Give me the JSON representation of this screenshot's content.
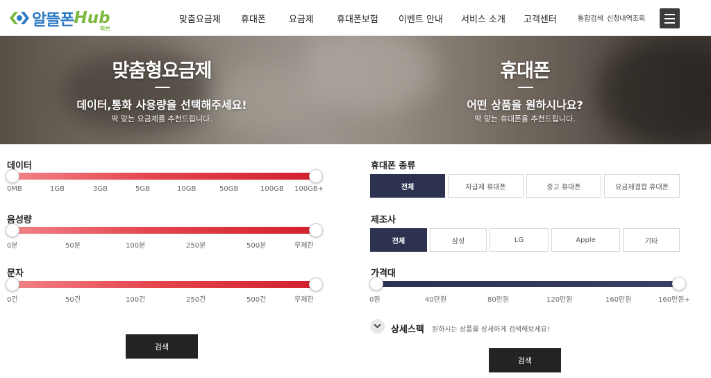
{
  "header": {
    "logo_main": "알뜰폰",
    "logo_hub": "Hub",
    "logo_sub": "허브",
    "nav": [
      "맞춤요금제",
      "휴대폰",
      "요금제",
      "휴대폰보험",
      "이벤트 안내",
      "서비스 소개",
      "고객센터"
    ],
    "util": [
      "통합검색",
      "신청내역조회"
    ]
  },
  "hero": {
    "left": {
      "title": "맞춤형요금제",
      "subtitle": "데이터,통화 사용량을 선택해주세요!",
      "desc": "딱 맞는 요금제를 추천드립니다."
    },
    "right": {
      "title": "휴대폰",
      "subtitle": "어떤 상품을 원하시나요?",
      "desc": "딱 맞는 휴대폰을 추천드립니다."
    }
  },
  "plan": {
    "data": {
      "label": "데이터",
      "ticks": [
        "0MB",
        "1GB",
        "3GB",
        "5GB",
        "10GB",
        "50GB",
        "100GB",
        "100GB+"
      ],
      "value": "100GB+"
    },
    "voice": {
      "label": "음성량",
      "ticks": [
        "0분",
        "50분",
        "100분",
        "250분",
        "500분",
        "무제한"
      ],
      "value": "무제한"
    },
    "sms": {
      "label": "문자",
      "ticks": [
        "0건",
        "50건",
        "100건",
        "250건",
        "500건",
        "무제한"
      ],
      "value": "무제한"
    },
    "search_label": "검색"
  },
  "phone": {
    "type": {
      "label": "휴대폰 종류",
      "options": [
        "전체",
        "자급제 휴대폰",
        "중고 휴대폰",
        "요금제결합 휴대폰"
      ],
      "selected": "전체"
    },
    "maker": {
      "label": "제조사",
      "options": [
        "전체",
        "삼성",
        "LG",
        "Apple",
        "기타"
      ],
      "selected": "전체"
    },
    "price": {
      "label": "가격대",
      "ticks": [
        "0원",
        "40만원",
        "80만원",
        "120만원",
        "160만원",
        "160만원+"
      ],
      "range": [
        "0원",
        "160만원+"
      ]
    },
    "detail": {
      "label": "상세스펙",
      "desc": "원하시는 상품을 상세하게 검색해보세요!"
    },
    "search_label": "검색"
  },
  "colors": {
    "accent_red": "#d21f2b",
    "navy": "#2d3250",
    "logo_blue": "#2e7bc4",
    "logo_green": "#7cb83e"
  }
}
